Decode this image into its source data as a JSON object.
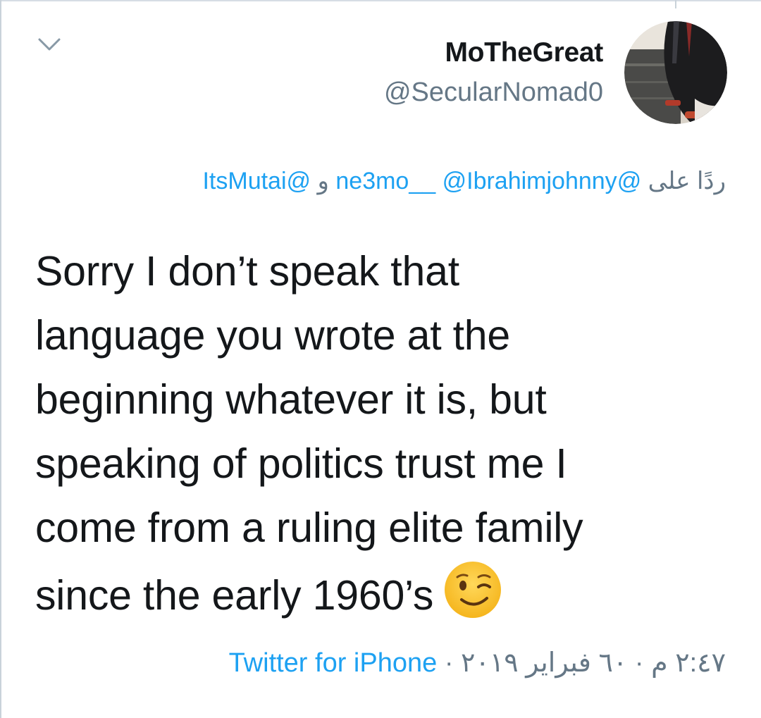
{
  "tweet": {
    "display_name": "MoTheGreat",
    "handle": "@SecularNomad0",
    "reply": {
      "prefix": "ردًا على",
      "mentions": [
        "@ne3mo__",
        "@Ibrahimjohnny",
        "@ItsMutai"
      ],
      "conjunction": "و"
    },
    "text_lines": [
      "Sorry I don’t speak that",
      "language you wrote at the",
      "beginning whatever it is, but",
      "speaking of politics trust me I",
      "come from a ruling elite family",
      "since the early 1960’s"
    ],
    "emoji": "winking-face",
    "time": "٢:٤٧ م",
    "date": "٦٠ فبراير ٢٠١٩",
    "separator": "·",
    "source": "Twitter for iPhone"
  },
  "icons": {
    "menu": "chevron-down-icon"
  },
  "colors": {
    "link": "#1da1f2",
    "secondary": "#657786",
    "text": "#14171a"
  }
}
